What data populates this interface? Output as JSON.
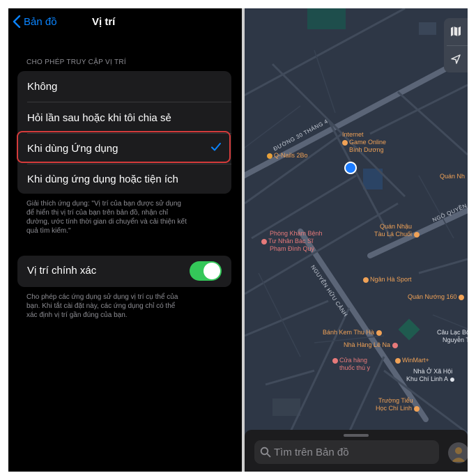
{
  "nav": {
    "back_label": "Bản đồ",
    "title": "Vị trí"
  },
  "location_access": {
    "header": "CHO PHÉP TRUY CẬP VỊ TRÍ",
    "options": [
      {
        "label": "Không"
      },
      {
        "label": "Hỏi lần sau hoặc khi tôi chia sẻ"
      },
      {
        "label": "Khi dùng Ứng dụng",
        "selected": true
      },
      {
        "label": "Khi dùng ứng dụng hoặc tiện ích"
      }
    ],
    "footer_lines": [
      "Giải thích ứng dụng: \"Vị trí của bạn được sử dụng",
      "để hiển thị vị trí của bạn trên bản đồ, nhận chỉ",
      "đường, ước tính thời gian di chuyển và cải thiện kết",
      "quả tìm kiếm.\""
    ]
  },
  "precise": {
    "label": "Vị trí chính xác",
    "enabled": true,
    "footer_lines": [
      "Cho phép các ứng dụng sử dụng vị trí cụ thể của",
      "bạn. Khi tắt cài đặt này, các ứng dụng chỉ có thể",
      "xác định vị trí gần đúng của bạn."
    ]
  },
  "map": {
    "pois": [
      {
        "id": "internet",
        "lines": [
          "Internet",
          "Game Online",
          "Bình Dương"
        ]
      },
      {
        "id": "qnails",
        "lines": [
          "Q-Nails 2Bo"
        ]
      },
      {
        "id": "quan-nhau-right",
        "lines": [
          "Quán Nh"
        ]
      },
      {
        "id": "phong-kham",
        "lines": [
          "Phòng Khám Bệnh",
          "Tư Nhân Bác Sĩ",
          "Phạm Đình Quý"
        ]
      },
      {
        "id": "quan-nhau-tau",
        "lines": [
          "Quán Nhậu",
          "Tàu Lá Chuối"
        ]
      },
      {
        "id": "ngan-ha",
        "lines": [
          "Ngân Hà Sport"
        ]
      },
      {
        "id": "quan-nuong",
        "lines": [
          "Quán Nướng 160"
        ]
      },
      {
        "id": "banh-kem",
        "lines": [
          "Bánh Kem Thu Hà"
        ]
      },
      {
        "id": "cau-lac-bo",
        "lines": [
          "Câu Lạc Bộ C",
          "Nguyễn Tri"
        ]
      },
      {
        "id": "nha-hang",
        "lines": [
          "Nhà Hàng Lê Na"
        ]
      },
      {
        "id": "cua-hang",
        "lines": [
          "Cửa hàng",
          "thuốc thú y"
        ]
      },
      {
        "id": "winmart",
        "lines": [
          "WinMart+"
        ]
      },
      {
        "id": "nha-o",
        "lines": [
          "Nhà Ở Xã Hội",
          "Khu Chí Linh A"
        ]
      },
      {
        "id": "truong",
        "lines": [
          "Trường Tiểu",
          "Học Chí Linh"
        ]
      }
    ],
    "streets": [
      {
        "id": "s1",
        "label": "ĐƯỜNG 30 THÁNG 4"
      },
      {
        "id": "s2",
        "label": "NGUYỄN HỮU CẢNH"
      },
      {
        "id": "s3",
        "label": "NGÔ QUYỀN"
      }
    ],
    "search_placeholder": "Tìm trên Bản đồ",
    "icons": {
      "map_mode": "map-icon",
      "location": "location-arrow-icon",
      "search": "magnifier-icon"
    }
  }
}
